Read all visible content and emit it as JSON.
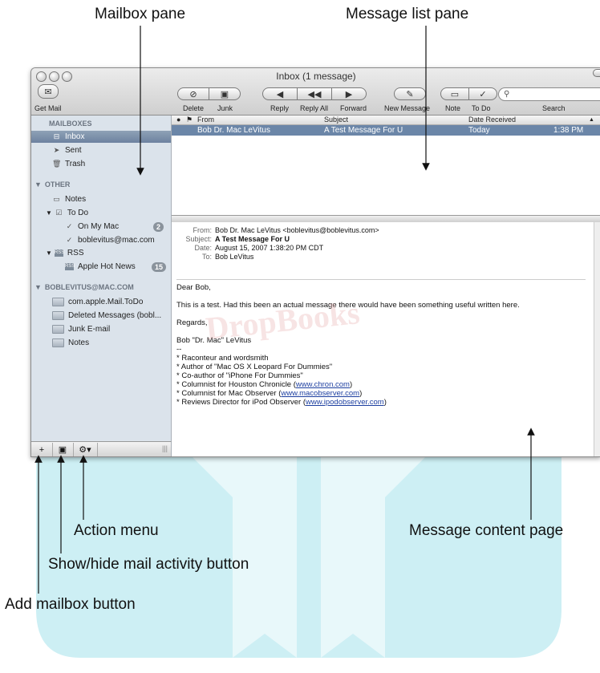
{
  "callouts": {
    "mailbox_pane": "Mailbox pane",
    "message_list_pane": "Message list pane",
    "action_menu": "Action menu",
    "show_hide": "Show/hide mail activity button",
    "add_mailbox": "Add mailbox button",
    "message_content": "Message content page"
  },
  "window": {
    "title": "Inbox (1 message)"
  },
  "toolbar": {
    "get_mail": "Get Mail",
    "delete": "Delete",
    "junk": "Junk",
    "reply": "Reply",
    "reply_all": "Reply All",
    "forward": "Forward",
    "new_message": "New Message",
    "note": "Note",
    "todo": "To Do",
    "search": "Search"
  },
  "sidebar": {
    "mailboxes_header": "MAILBOXES",
    "inbox": "Inbox",
    "sent": "Sent",
    "trash": "Trash",
    "other_header": "OTHER",
    "notes": "Notes",
    "todo": "To Do",
    "on_my_mac": "On My Mac",
    "on_my_mac_count": "2",
    "account_todo": "boblevitus@mac.com",
    "rss": "RSS",
    "apple_hot_news": "Apple Hot News",
    "apple_hot_news_count": "15",
    "account_header": "BOBLEVITUS@MAC.COM",
    "folders": [
      "com.apple.Mail.ToDo",
      "Deleted Messages (bobl...",
      "Junk E-mail",
      "Notes"
    ]
  },
  "list": {
    "columns": {
      "from": "From",
      "subject": "Subject",
      "date": "Date Received"
    },
    "rows": [
      {
        "from": "Bob Dr. Mac LeVitus",
        "subject": "A Test Message For U",
        "date": "Today",
        "time": "1:38 PM"
      }
    ]
  },
  "message": {
    "from_label": "From:",
    "from": "Bob Dr. Mac LeVitus <boblevitus@boblevitus.com>",
    "subject_label": "Subject:",
    "subject": "A Test Message For U",
    "date_label": "Date:",
    "date": "August 15, 2007 1:38:20 PM CDT",
    "to_label": "To:",
    "to": "Bob LeVitus",
    "body": {
      "greeting": "Dear Bob,",
      "line1": "This is a test. Had this been an actual message there would have been something useful written here.",
      "regards": "Regards,",
      "signature_name": "Bob \"Dr. Mac\" LeVitus",
      "dashes": "--",
      "sig1": "* Raconteur and wordsmith",
      "sig2": "* Author of \"Mac OS X Leopard For Dummies\"",
      "sig3": "* Co-author of \"iPhone For Dummies\"",
      "sig4_pre": "* Columnist for Houston Chronicle (",
      "sig4_link": "www.chron.com",
      "sig5_pre": "* Columnist for Mac Observer (",
      "sig5_link": "www.macobserver.com",
      "sig6_pre": "* Reviews Director for iPod Observer (",
      "sig6_link": "www.ipodobserver.com",
      "close_paren": ")"
    }
  },
  "watermark": "DropBooks",
  "colors": {
    "accent_blue": "#6b86a8",
    "background_shape": "#cdeff4"
  }
}
